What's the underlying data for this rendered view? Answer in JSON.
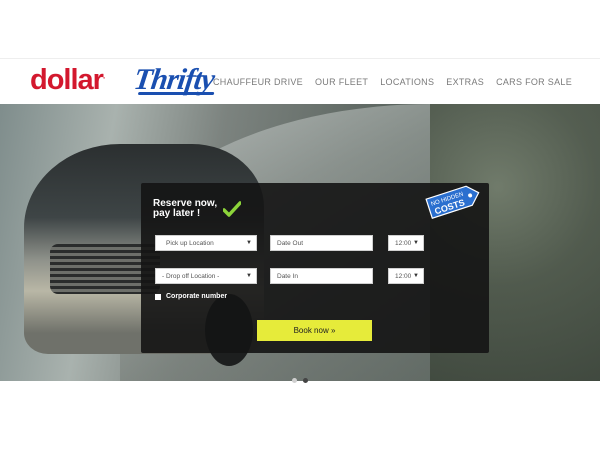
{
  "brand": {
    "dollar": {
      "text": "dollar",
      "dot": ".",
      "color": "#d3182e"
    },
    "thrifty": {
      "text": "Thrifty",
      "color": "#1a4fb0"
    }
  },
  "nav": {
    "items": [
      "CHAUFFEUR DRIVE",
      "OUR FLEET",
      "LOCATIONS",
      "EXTRAS",
      "CARS FOR SALE"
    ]
  },
  "booking": {
    "title_line1": "Reserve now,",
    "title_line2": "pay later !",
    "badge_line1": "NO HIDDEN",
    "badge_line2": "COSTS",
    "pickup_value": "Pick up Location",
    "dropoff_value": "- Drop off Location -",
    "date_out_placeholder": "Date Out",
    "date_in_placeholder": "Date In",
    "time_out_value": "12:00",
    "time_in_value": "12:00",
    "corporate_label": "Corporate number",
    "book_label": "Book now »",
    "accent_color": "#e6eb3a"
  },
  "carousel": {
    "slide_count": 2,
    "active_index": 2
  },
  "icons": {
    "check": "check-icon",
    "badge": "price-tag-icon"
  }
}
